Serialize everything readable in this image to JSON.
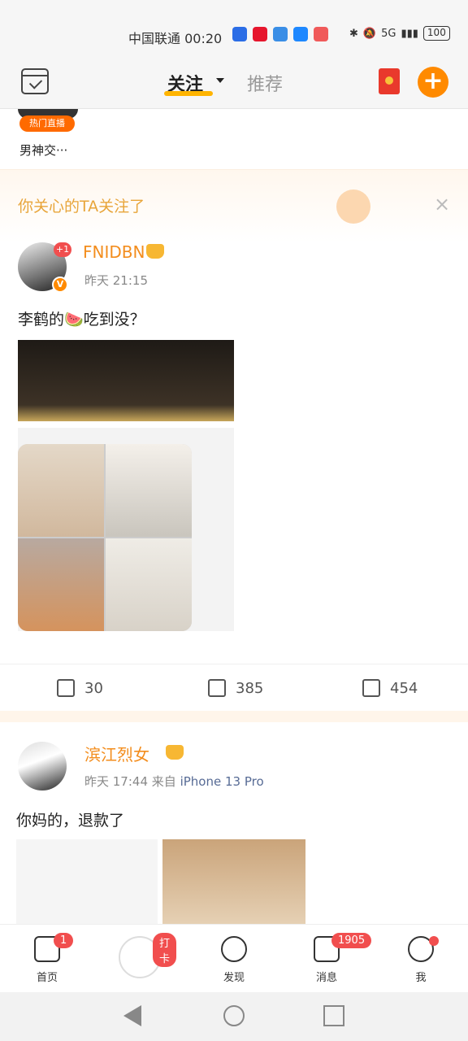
{
  "status": {
    "carrier": "中国联通 00:20",
    "battery": "100",
    "signal": "5G"
  },
  "nav": {
    "follow": "关注",
    "recommend": "推荐"
  },
  "live": {
    "badge": "热门直播",
    "name": "男神交···"
  },
  "banner": {
    "text": "你关心的TA关注了",
    "close": "×"
  },
  "post1": {
    "user": "FNIDBN",
    "badge_plus": "+1",
    "verified": "V",
    "time": "昨天 21:15",
    "text": "李鹤的🍉吃到没？",
    "repost": "30",
    "comment": "385",
    "like": "454"
  },
  "post2": {
    "user": "滨江烈女",
    "time": "昨天 17:44",
    "from": "来自",
    "source": "iPhone 13 Pro",
    "text": "你妈的，退款了"
  },
  "bottom": {
    "home": "首页",
    "home_badge": "1",
    "checkin": "打卡",
    "discover": "发现",
    "message": "消息",
    "message_badge": "1905",
    "me": "我"
  }
}
